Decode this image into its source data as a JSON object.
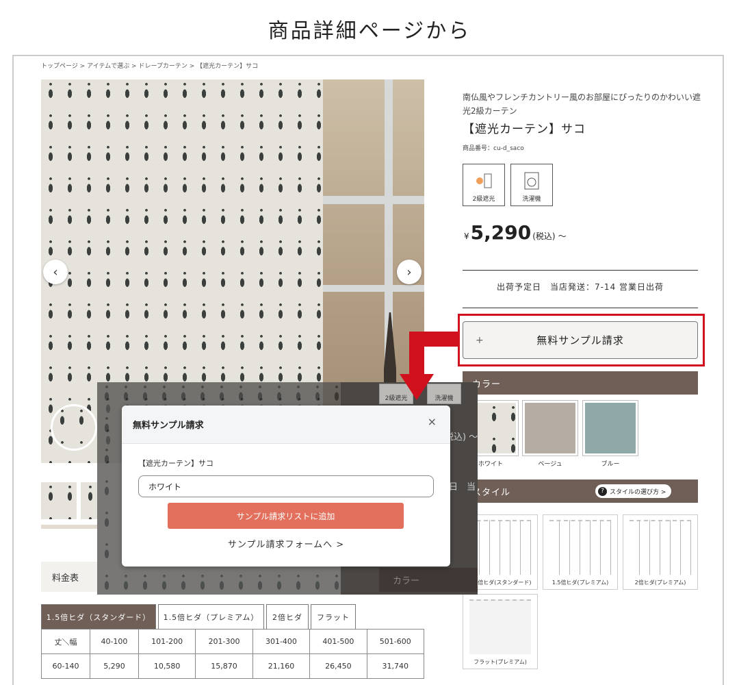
{
  "page_title": "商品詳細ページから",
  "breadcrumb": "トップページ > アイテムで選ぶ > ドレープカーテン > 【遮光カーテン】サコ",
  "product": {
    "description": "南仏風やフレンチカントリー風のお部屋にぴったりのかわいい遮光2級カーテン",
    "name": "【遮光カーテン】サコ",
    "code": "商品番号：cu-d_saco",
    "features": [
      {
        "label": "2級遮光",
        "icon": "blackout-icon"
      },
      {
        "label": "洗濯機",
        "icon": "washing-machine-icon"
      }
    ],
    "price_symbol": "¥",
    "price": "5,290",
    "price_tax": "(税込)",
    "price_suffix": "～",
    "shipping": "出荷予定日　当店発送：7-14 営業日出荷",
    "sample_button": "無料サンプル請求",
    "sample_plus": "+"
  },
  "color_section": {
    "title": "カラー",
    "swatches": [
      {
        "label": "ホワイト",
        "color": "#e6e3dc"
      },
      {
        "label": "ベージュ",
        "color": "#b5aca4"
      },
      {
        "label": "ブルー",
        "color": "#8fa9a9"
      }
    ]
  },
  "style_section": {
    "title": "スタイル",
    "guide_link": "スタイルの選び方 >",
    "guide_icon": "?",
    "options": [
      "1.5倍ヒダ(スタンダード)",
      "1.5倍ヒダ(プレミアム)",
      "2倍ヒダ(プレミアム)",
      "フラット(プレミアム)"
    ]
  },
  "gallery": {
    "prev": "‹",
    "next": "›"
  },
  "rate": {
    "title": "料金表",
    "tabs": [
      "1.5倍ヒダ（スタンダード）",
      "1.5倍ヒダ（プレミアム）",
      "2倍ヒダ",
      "フラット"
    ],
    "headers": [
      "丈＼幅",
      "40-100",
      "101-200",
      "201-300",
      "301-400",
      "401-500",
      "501-600"
    ],
    "rows": [
      [
        "60-140",
        "5,290",
        "10,580",
        "15,870",
        "21,160",
        "26,450",
        "31,740"
      ]
    ]
  },
  "overlay": {
    "features": [
      "2級遮光",
      "洗濯機"
    ],
    "price_fragment": "税込) ～",
    "ship_fragment": "日　当",
    "color_label": "カラー"
  },
  "modal": {
    "title": "無料サンプル請求",
    "close": "×",
    "product": "【遮光カーテン】サコ",
    "selected": "ホワイト",
    "add_button": "サンプル請求リストに追加",
    "form_link": "サンプル請求フォームへ >"
  },
  "colors": {
    "accent_red": "#d0101c",
    "header_brown": "#6f5f57",
    "add_button": "#e2705d"
  }
}
